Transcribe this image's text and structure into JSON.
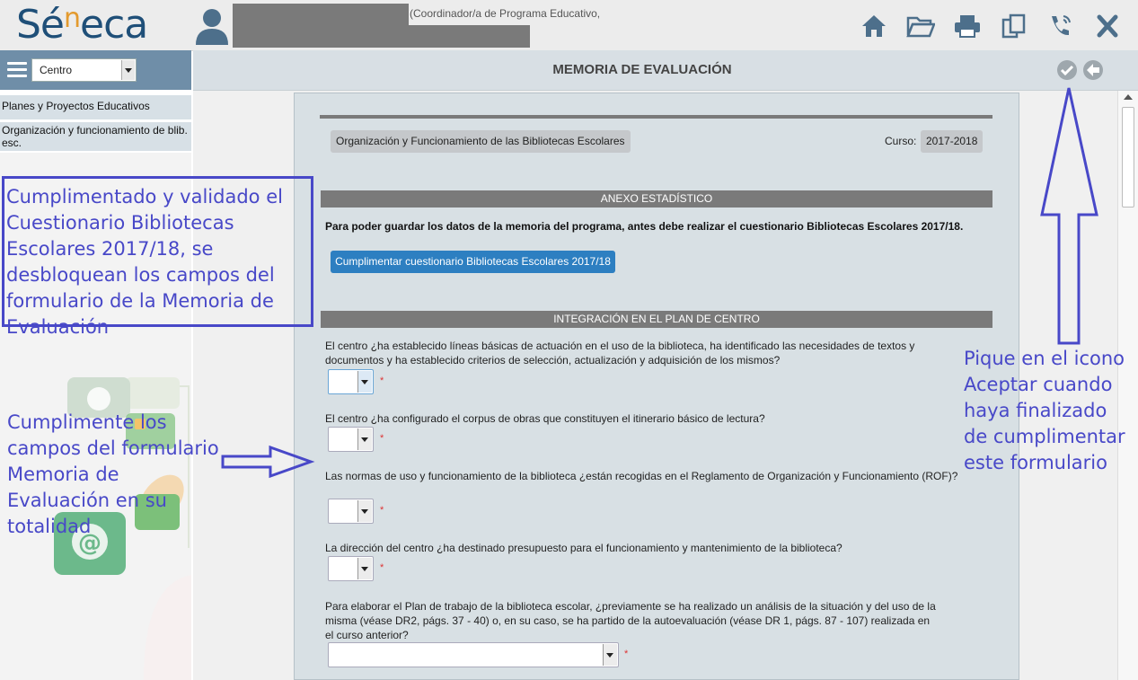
{
  "header": {
    "logo_text_a": "Sé",
    "logo_text_sup": "n",
    "logo_text_b": "eca",
    "user_role": "(Coordinador/a de Programa Educativo,",
    "icons": [
      "home-icon",
      "folder-open-icon",
      "print-icon",
      "copy-icon",
      "phone-icon",
      "close-icon"
    ]
  },
  "sidebar": {
    "select_value": "Centro",
    "items": [
      {
        "label": "Planes y Proyectos Educativos"
      },
      {
        "label": "Organización y funcionamiento de blib. esc."
      }
    ]
  },
  "main": {
    "title": "MEMORIA DE EVALUACIÓN",
    "program": "Organización y Funcionamiento de las Bibliotecas Escolares",
    "curso_label": "Curso:",
    "curso_value": "2017-2018",
    "section_anexo": "ANEXO ESTADÍSTICO",
    "notice": "Para poder guardar los datos de la memoria del programa, antes debe realizar el cuestionario Bibliotecas Escolares 2017/18.",
    "questionnaire_button": "Cumplimentar cuestionario Bibliotecas Escolares 2017/18",
    "section_integracion": "INTEGRACIÓN EN EL PLAN DE CENTRO",
    "required_mark": "*",
    "questions": [
      {
        "text": "El centro ¿ha establecido líneas básicas de actuación en el uso de la biblioteca, ha identificado las necesidades de textos y documentos y ha establecido criterios de selección, actualización y adquisición de los mismos?"
      },
      {
        "text": "El centro ¿ha configurado el corpus de obras que constituyen el itinerario básico de lectura?"
      },
      {
        "text": "Las normas de uso y funcionamiento de la biblioteca ¿están recogidas en el Reglamento de Organización y Funcionamiento (ROF)?"
      },
      {
        "text": "La dirección del centro ¿ha destinado presupuesto para el funcionamiento y mantenimiento de la biblioteca?"
      },
      {
        "text": "Para elaborar el Plan de trabajo de la biblioteca escolar, ¿previamente se ha realizado un análisis de la situación y del uso de la misma (véase DR2, págs. 37 - 40) o, en su caso, se ha partido de la autoevaluación (véase DR 1, págs. 87 - 107) realizada en el curso anterior?"
      }
    ]
  },
  "annotations": {
    "box_text": "Cumplimentado y validado el Cuestionario Bibliotecas Escolares 2017/18, se desbloquean los campos del formulario de la Memoria de Evaluación",
    "left_text": "Cumplimente los campos del formulario Memoria de Evaluación en su totalidad",
    "right_text": "Pique en el icono Aceptar cuando haya finalizado de cumplimentar este formulario",
    "color": "#4848c8"
  }
}
